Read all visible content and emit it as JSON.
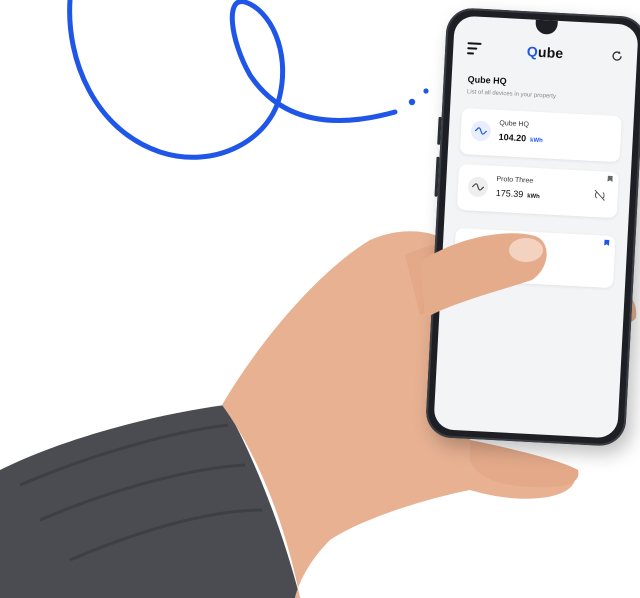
{
  "app": {
    "brand_q": "Q",
    "brand_rest": "ube"
  },
  "page": {
    "title": "Qube HQ",
    "subtitle": "List of all devices in your property"
  },
  "devices": [
    {
      "name": "Qube HQ",
      "value": "104.20",
      "unit": "kWh",
      "active": true,
      "icon": "waveform-icon"
    },
    {
      "name": "Proto Three",
      "value": "175.39",
      "unit": "kWh",
      "active": false,
      "icon": "waveform-icon",
      "status_icon": "signal-off-icon"
    },
    {
      "name": "",
      "value": "",
      "unit": "",
      "active": true,
      "obscured": true
    }
  ],
  "colors": {
    "accent": "#1f56e8",
    "doodle": "#1f56e8",
    "skin": "#e7b192",
    "sleeve": "#4a4c52"
  }
}
